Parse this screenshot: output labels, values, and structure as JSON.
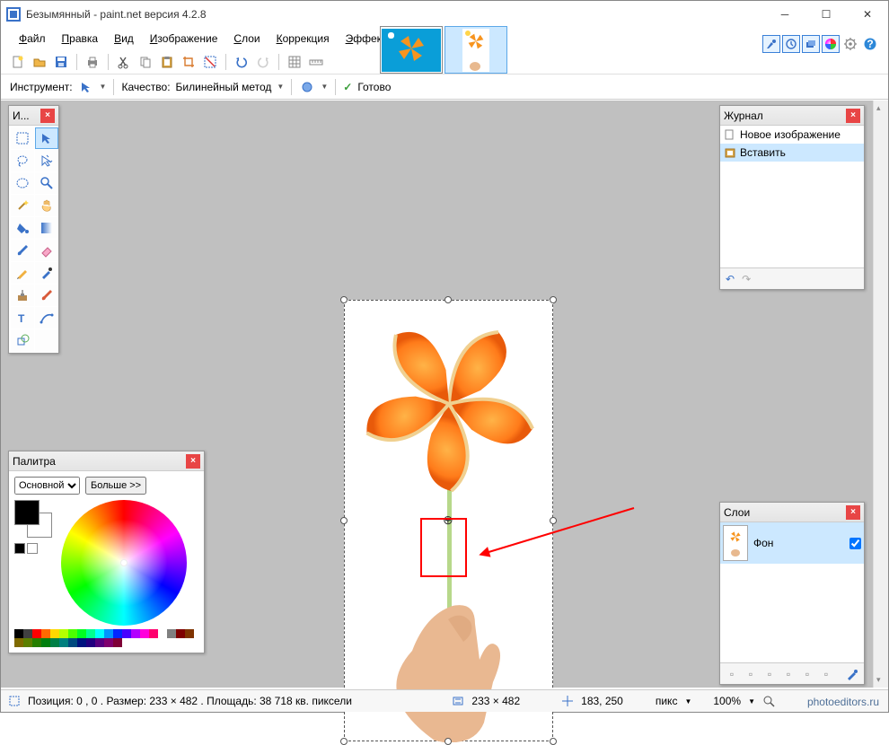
{
  "title": "Безымянный - paint.net версия 4.2.8",
  "menu": {
    "file": "Файл",
    "edit": "Правка",
    "view": "Вид",
    "image": "Изображение",
    "layers": "Слои",
    "adjust": "Коррекция",
    "effects": "Эффекты"
  },
  "toolbar2": {
    "tool_label": "Инструмент:",
    "quality_label": "Качество:",
    "quality_value": "Билинейный метод",
    "ready": "Готово"
  },
  "tools_panel_title": "И...",
  "history": {
    "title": "Журнал",
    "items": [
      "Новое изображение",
      "Вставить"
    ],
    "active_index": 1
  },
  "layers": {
    "title": "Слои",
    "item": "Фон",
    "checked": true
  },
  "palette": {
    "title": "Палитра",
    "mode": "Основной",
    "more": "Больше >>",
    "primary": "#000000",
    "secondary": "#ffffff"
  },
  "status": {
    "selinfo": "Позиция: 0 , 0 . Размер: 233  × 482 . Площадь: 38 718 кв. пиксели",
    "canvas_size": "233 × 482",
    "cursor": "183, 250",
    "units": "пикс",
    "zoom": "100%"
  },
  "watermark": "photoeditors.ru",
  "swatch_colors": [
    "#000",
    "#404040",
    "#ff0000",
    "#ff6a00",
    "#ffd800",
    "#b6ff00",
    "#4cff00",
    "#00ff21",
    "#00ff90",
    "#00ffff",
    "#0094ff",
    "#0026ff",
    "#4800ff",
    "#b200ff",
    "#ff00dc",
    "#ff006e",
    "#fff",
    "#808080",
    "#7f0000",
    "#7f3300",
    "#7f6a00",
    "#5b7f00",
    "#267f00",
    "#007f0e",
    "#007f46",
    "#007f7f",
    "#004a7f",
    "#00137f",
    "#21007f",
    "#57007f",
    "#7f006e",
    "#7f0037"
  ]
}
